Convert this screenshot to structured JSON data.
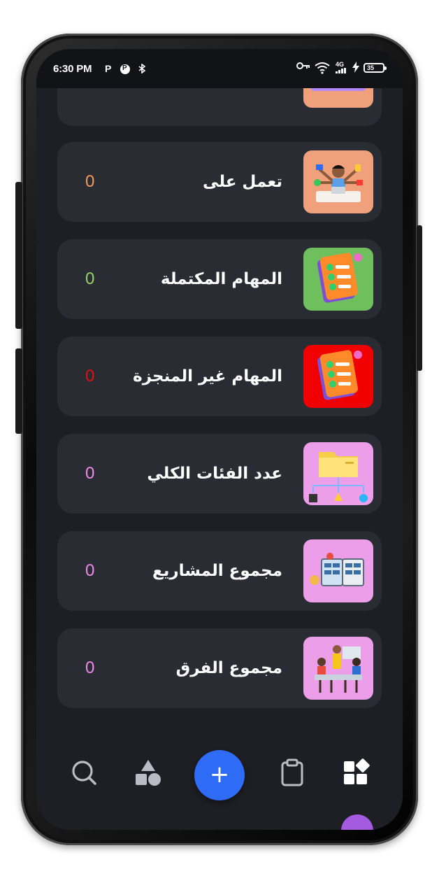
{
  "status_bar": {
    "time": "6:30 PM",
    "notif_p": "P",
    "network_label": "4G",
    "battery_level": "35"
  },
  "colors": {
    "screen_bg": "#1e1f24",
    "card_bg": "#2a2c33",
    "fab": "#2f6cf6",
    "accent_purple": "#a45be0"
  },
  "cards": [
    {
      "title": "تعمل على",
      "count": "0",
      "count_color": "#f2995e",
      "icon": "multitask-person-icon",
      "icon_bg": "#f0a07a"
    },
    {
      "title": "المهام المكتملة",
      "count": "0",
      "count_color": "#9ad06a",
      "icon": "completed-checklist-icon",
      "icon_bg": "#6fbf5f"
    },
    {
      "title": "المهام غير المنجزة",
      "count": "0",
      "count_color": "#e01010",
      "icon": "pending-checklist-icon",
      "icon_bg": "#f00000"
    },
    {
      "title": "عدد الفئات الكلي",
      "count": "0",
      "count_color": "#f08ae8",
      "icon": "category-folder-icon",
      "icon_bg": "#ec9ee8"
    },
    {
      "title": "مجموع المشاريع",
      "count": "0",
      "count_color": "#f08ae8",
      "icon": "projects-board-icon",
      "icon_bg": "#ec9ee8"
    },
    {
      "title": "مجموع الفرق",
      "count": "0",
      "count_color": "#f08ae8",
      "icon": "team-meeting-icon",
      "icon_bg": "#ec9ee8"
    }
  ],
  "bottom_nav": {
    "items": [
      "search-icon",
      "categories-shapes-icon",
      "add-button",
      "clipboard-icon",
      "dashboard-icon"
    ],
    "fab_label": "+"
  }
}
